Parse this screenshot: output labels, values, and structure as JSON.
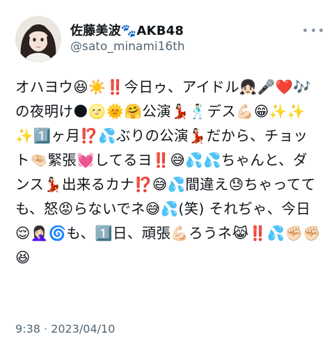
{
  "tweet": {
    "author": {
      "display_name": "佐藤美波🐾AKB48",
      "handle": "@sato_minami16th"
    },
    "text": "オハヨウ😆☀️‼️今日ゥ、アイドル👧🏻🎤❤️🎶の夜明け🌑🌝🌞🤗公演💃🏻🕺🏻デス💪🏻😁✨✨✨1️⃣ヶ月⁉️💦ぶりの公演💃🏻だから、チョット🤏🏻緊張💓してるヨ‼️😅💦💦ちゃんと、ダンス💃🏻出来るカナ⁉️😅💦間違え😓ちゃってても、怒😡らないでネ😅💦(笑) それぢゃ、今日😌🤦🏻‍♀️🌀も、1️⃣日、頑張💪🏻ろうネ😹‼️💦✊🏻✊🏻😆",
    "timestamp": "9:38 · 2023/04/10"
  },
  "icons": {
    "avatar": "avatar-photo",
    "more": "more-options-icon"
  },
  "colors": {
    "text": "#0f1419",
    "secondary_text": "#536471",
    "background": "#ffffff"
  }
}
